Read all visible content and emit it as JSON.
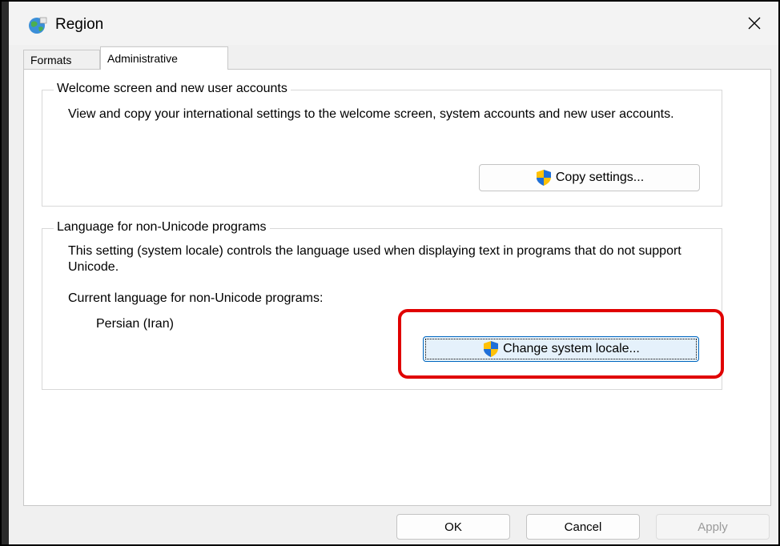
{
  "window": {
    "title": "Region",
    "app_icon": "globe-icon",
    "close_icon": "close-icon"
  },
  "tabs": [
    {
      "label": "Formats",
      "active": false
    },
    {
      "label": "Administrative",
      "active": true
    }
  ],
  "welcome_group": {
    "legend": "Welcome screen and new user accounts",
    "description": "View and copy your international settings to the welcome screen, system accounts and new user accounts.",
    "copy_button_label": "Copy settings...",
    "copy_button_icon": "uac-shield-icon"
  },
  "language_group": {
    "legend": "Language for non-Unicode programs",
    "description": "This setting (system locale) controls the language used when displaying text in programs that do not support Unicode.",
    "current_label": "Current language for non-Unicode programs:",
    "current_value": "Persian (Iran)",
    "change_button_label": "Change system locale...",
    "change_button_icon": "uac-shield-icon"
  },
  "annotation": {
    "highlight_color": "#e00000"
  },
  "footer": {
    "ok_label": "OK",
    "cancel_label": "Cancel",
    "apply_label": "Apply"
  },
  "colors": {
    "accent": "#0067c0",
    "highlight": "#e00000"
  }
}
